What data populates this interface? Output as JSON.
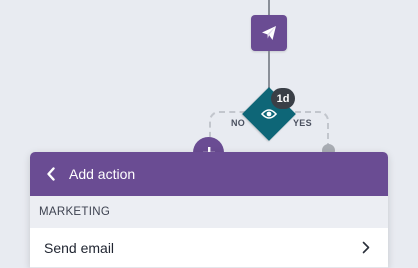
{
  "canvas": {
    "branches": {
      "no_label": "NO",
      "yes_label": "YES"
    },
    "condition": {
      "delay_badge": "1d",
      "icon": "eye-icon"
    },
    "send_node": {
      "icon": "paper-plane-icon"
    },
    "add_step": {
      "icon": "plus-icon"
    }
  },
  "panel": {
    "title": "Add action",
    "back_icon": "chevron-left-icon",
    "sections": [
      {
        "name": "MARKETING",
        "items": [
          {
            "label": "Send email",
            "icon": "chevron-right-icon"
          }
        ]
      }
    ]
  },
  "colors": {
    "brand_purple": "#6a4c93",
    "condition_teal": "#0e6677",
    "canvas_bg": "#e8ebf1"
  }
}
